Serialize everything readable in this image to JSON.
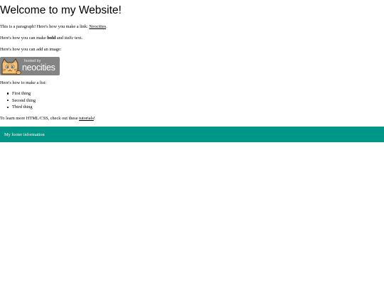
{
  "header": {
    "title": "Welcome to my Website!"
  },
  "intro": {
    "text_before": "This is a paragraph! Here's how you make a link: ",
    "link_text": "Neocities",
    "text_after": "."
  },
  "formatting": {
    "text_before": "Here's how you can make ",
    "bold_text": "bold",
    "text_middle": " and ",
    "italic_text": "italic",
    "text_after": " text."
  },
  "image_section": {
    "text": "Here's how you can add an image:",
    "badge": {
      "small_text": "hosted by",
      "big_text": "neocities",
      "background_color": "#848484",
      "icon": "neocities-cat-icon"
    }
  },
  "list_section": {
    "text": "Here's how to make a list:",
    "items": [
      "First thing",
      "Second thing",
      "Third thing"
    ]
  },
  "learn_more": {
    "text_before": "To learn more HTML/CSS, check out these ",
    "link_text": "tutorials",
    "text_after": "!"
  },
  "footer": {
    "text": "My footer information",
    "background_color": "#009688"
  }
}
